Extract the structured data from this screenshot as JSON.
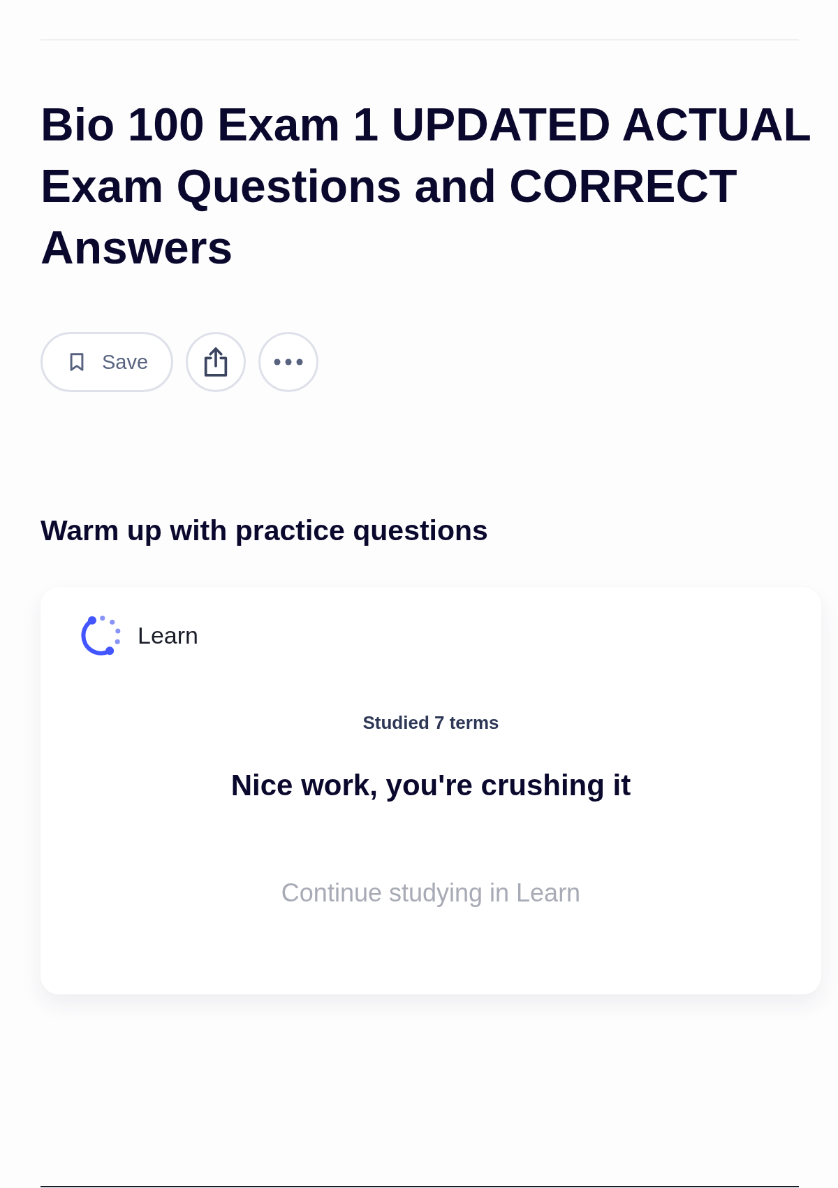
{
  "title": "Bio 100 Exam 1 UPDATED ACTUAL Exam Questions and CORRECT Answers",
  "actions": [
    {
      "kind": "save",
      "label": "Save"
    },
    {
      "kind": "share"
    },
    {
      "kind": "more"
    }
  ],
  "practice": {
    "heading": "Warm up with practice questions",
    "card": {
      "mode": "Learn",
      "progress": "Studied 7 terms",
      "message": "Nice work, you're crushing it",
      "link": "Continue studying in Learn"
    }
  }
}
